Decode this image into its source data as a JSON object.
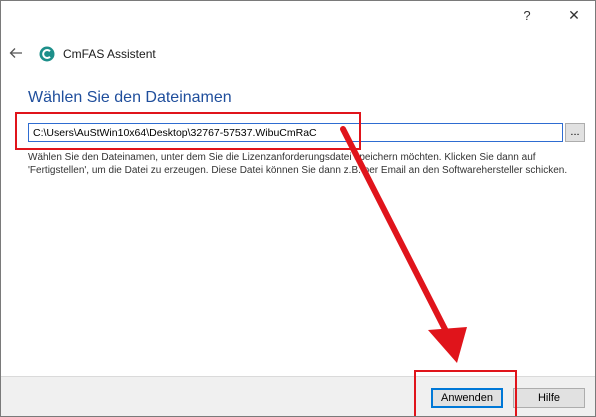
{
  "titlebar": {
    "help_label": "?",
    "close_label": "✕"
  },
  "header": {
    "back_icon": "back-arrow-icon",
    "app_icon": "cmfas-logo-icon",
    "app_title": "CmFAS Assistent"
  },
  "main": {
    "heading": "Wählen Sie den Dateinamen",
    "file_path": "C:\\Users\\AuStWin10x64\\Desktop\\32767-57537.WibuCmRaC",
    "browse_label": "...",
    "description": "Wählen Sie den Dateinamen, unter dem Sie die Lizenzanforderungsdatei speichern möchten. Klicken Sie dann auf 'Fertigstellen', um die Datei zu erzeugen. Diese Datei können Sie dann z.B. per Email an den Softwarehersteller schicken."
  },
  "footer": {
    "apply_label": "Anwenden",
    "help_label": "Hilfe"
  },
  "colors": {
    "heading": "#1f4e9c",
    "annotation": "#e0141b",
    "focus": "#0078d7"
  }
}
